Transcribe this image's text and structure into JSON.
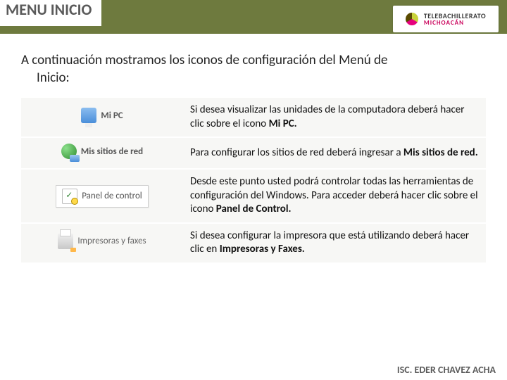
{
  "header": {
    "title": "MENU INICIO",
    "brand_top": "TELEBACHILLERATO",
    "brand_bottom": "MICHOACÁN"
  },
  "intro_line1": "A continuación mostramos los iconos de configuración del Menú de",
  "intro_line2": "Inicio:",
  "rows": [
    {
      "icon_label": "Mi PC",
      "desc_pre": "Si desea visualizar las unidades de la computadora deberá hacer clic sobre el icono ",
      "desc_bold": "Mi PC."
    },
    {
      "icon_label": "Mis sitios de red",
      "desc_pre": "Para configurar los sitios de red deberá ingresar a ",
      "desc_bold": "Mis sitios de red."
    },
    {
      "icon_label": "Panel de control",
      "desc_pre": "Desde este punto usted podrá controlar todas las herramientas de configuración del Windows. Para acceder deberá hacer clic sobre el icono ",
      "desc_bold": "Panel de Control."
    },
    {
      "icon_label": "Impresoras y faxes",
      "desc_pre": "Si desea configurar la impresora que está utilizando deberá hacer clic en ",
      "desc_bold": "Impresoras y Faxes."
    }
  ],
  "footer": "ISC. EDER CHAVEZ ACHA"
}
